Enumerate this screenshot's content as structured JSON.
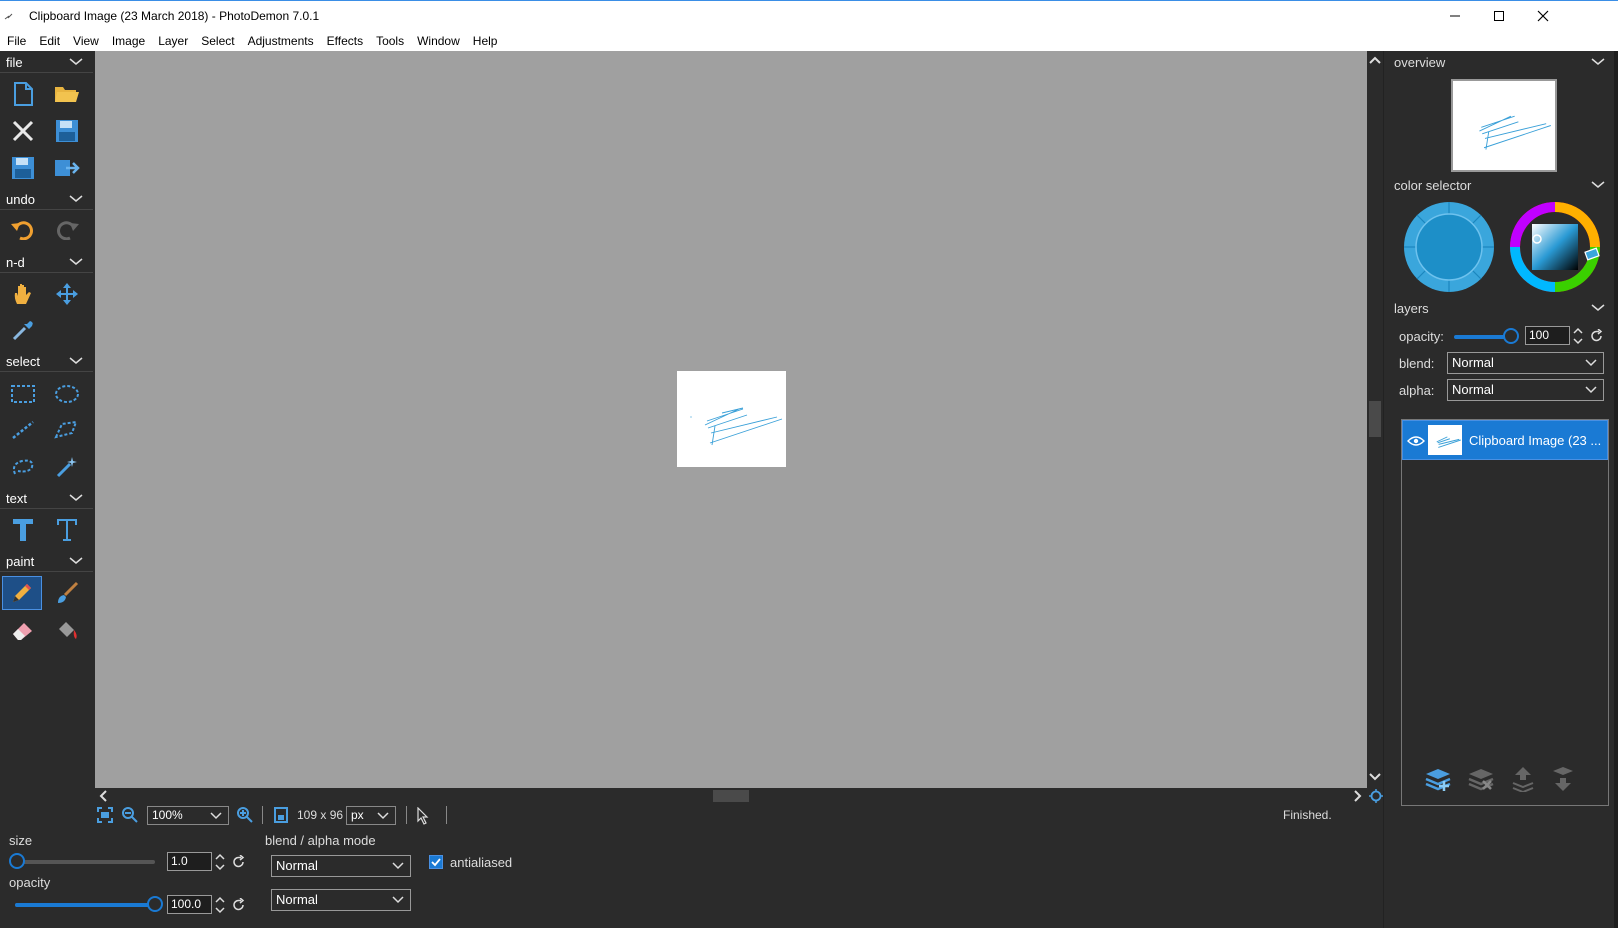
{
  "window": {
    "title": "Clipboard Image (23 March 2018)  -  PhotoDemon 7.0.1"
  },
  "menu": [
    "File",
    "Edit",
    "View",
    "Image",
    "Layer",
    "Select",
    "Adjustments",
    "Effects",
    "Tools",
    "Window",
    "Help"
  ],
  "toolbox": {
    "sections": {
      "file": "file",
      "undo": "undo",
      "nd": "n-d",
      "select": "select",
      "text": "text",
      "paint": "paint"
    }
  },
  "statusbar": {
    "zoom": "100%",
    "image_size": "109 x 96",
    "units": "px",
    "status": "Finished."
  },
  "tool_options": {
    "size_label": "size",
    "size_value": "1.0",
    "opacity_label": "opacity",
    "opacity_value": "100.0",
    "opacity_level": 1.0,
    "size_level": 0.0,
    "blend_label": "blend / alpha mode",
    "blend_mode": "Normal",
    "alpha_mode": "Normal",
    "antialiased_label": "antialiased",
    "antialiased_checked": true
  },
  "right_panel": {
    "overview_label": "overview",
    "color_selector_label": "color selector",
    "primary_color": "#1d8fc8",
    "layers_label": "layers",
    "opacity_label": "opacity:",
    "opacity_value": "100",
    "blend_label": "blend:",
    "blend_value": "Normal",
    "alpha_label": "alpha:",
    "alpha_value": "Normal",
    "layer_name": "Clipboard Image (23 ..."
  },
  "colors": {
    "accent": "#1a7ad4",
    "canvas_bg": "#a0a0a0",
    "panel_bg": "#2b2b2b",
    "icon_blue": "#4a9ee0"
  }
}
